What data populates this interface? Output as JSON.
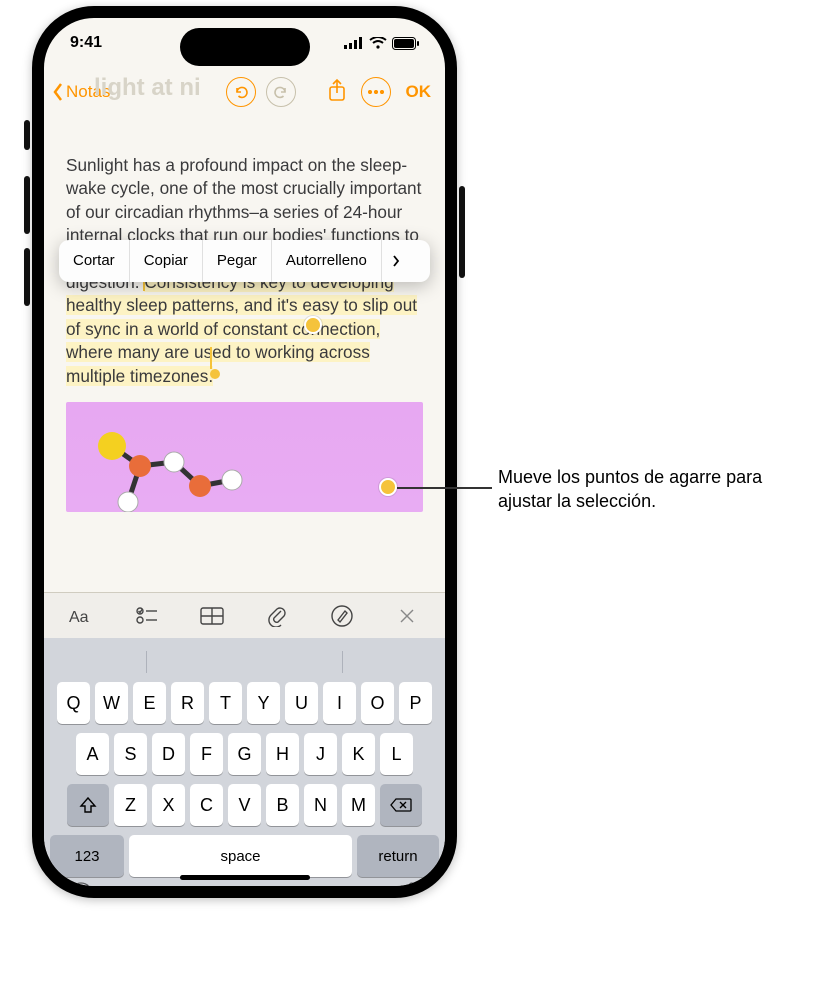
{
  "status": {
    "time": "9:41"
  },
  "nav": {
    "back_label": "Notas",
    "ok_label": "OK",
    "ghost_title": "light at ni"
  },
  "note": {
    "para_before_highlight": "Sunlight has a profound impact on the sleep-wake cycle, one of the most crucially important of our circadian rhythms–a series of 24-hour internal clocks that run our bodies' functions to optimize everything from wakefulness to digestion. ",
    "highlighted": "Consistency is key to developing healthy sleep patterns, and it's easy to slip out of sync in a world of constant connection, where many are used to working across multiple timezones."
  },
  "context_menu": {
    "items": [
      "Cortar",
      "Copiar",
      "Pegar",
      "Autorrelleno"
    ]
  },
  "format_bar": {
    "icons": [
      "text-format",
      "checklist",
      "table",
      "attachment",
      "markup",
      "close"
    ]
  },
  "keyboard": {
    "row1": [
      "Q",
      "W",
      "E",
      "R",
      "T",
      "Y",
      "U",
      "I",
      "O",
      "P"
    ],
    "row2": [
      "A",
      "S",
      "D",
      "F",
      "G",
      "H",
      "J",
      "K",
      "L"
    ],
    "row3": [
      "Z",
      "X",
      "C",
      "V",
      "B",
      "N",
      "M"
    ],
    "num_label": "123",
    "space_label": "space",
    "return_label": "return"
  },
  "callouts": {
    "grab": "Mueve los puntos de agarre para ajustar la selección."
  },
  "colors": {
    "accent": "#ff9500",
    "highlight": "#fdf3c4",
    "grab": "#f5c33b"
  }
}
